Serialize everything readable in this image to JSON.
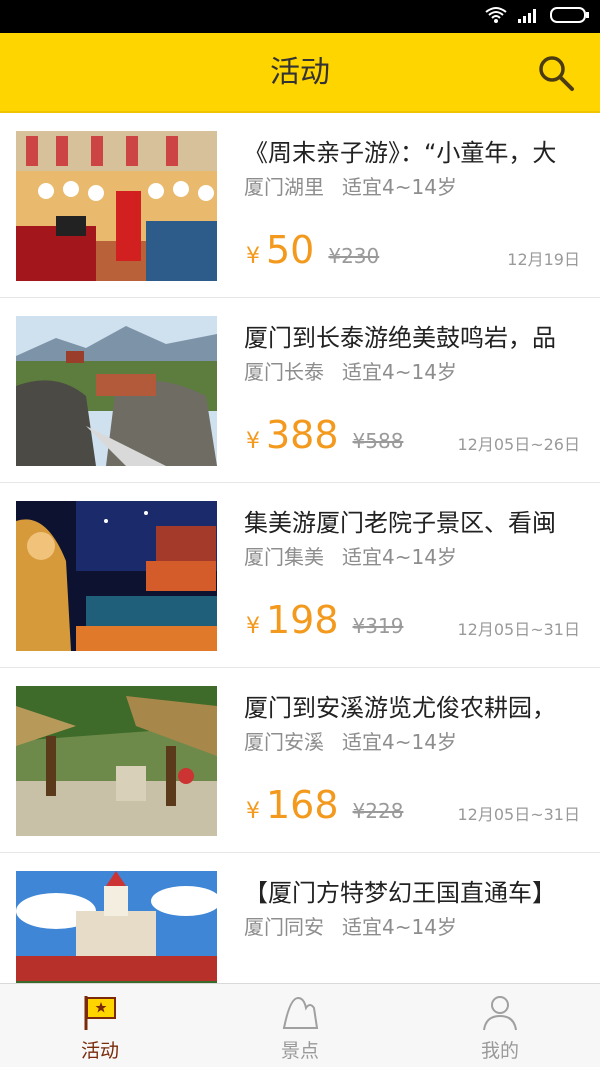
{
  "header": {
    "title": "活动"
  },
  "items": [
    {
      "title": "《周末亲子游》：“小童年，大",
      "location": "厦门湖里",
      "age": "适宜4~14岁",
      "currency": "¥",
      "price": "50",
      "original_price": "¥230",
      "date": "12月19日"
    },
    {
      "title": "厦门到长泰游绝美鼓鸣岩，品",
      "location": "厦门长泰",
      "age": "适宜4~14岁",
      "currency": "¥",
      "price": "388",
      "original_price": "¥588",
      "date": "12月05日~26日"
    },
    {
      "title": "集美游厦门老院子景区、看闽",
      "location": "厦门集美",
      "age": "适宜4~14岁",
      "currency": "¥",
      "price": "198",
      "original_price": "¥319",
      "date": "12月05日~31日"
    },
    {
      "title": "厦门到安溪游览尤俊农耕园，",
      "location": "厦门安溪",
      "age": "适宜4~14岁",
      "currency": "¥",
      "price": "168",
      "original_price": "¥228",
      "date": "12月05日~31日"
    },
    {
      "title": "【厦门方特梦幻王国直通车】",
      "location": "厦门同安",
      "age": "适宜4~14岁",
      "currency": "¥",
      "price": "",
      "original_price": "",
      "date": ""
    }
  ],
  "tabs": [
    {
      "label": "活动",
      "icon": "flag-star-icon",
      "active": true
    },
    {
      "label": "景点",
      "icon": "mountain-icon",
      "active": false
    },
    {
      "label": "我的",
      "icon": "person-icon",
      "active": false
    }
  ],
  "colors": {
    "header": "#FFD500",
    "price": "#F39A1E",
    "active_tab": "#7a2a0a"
  }
}
